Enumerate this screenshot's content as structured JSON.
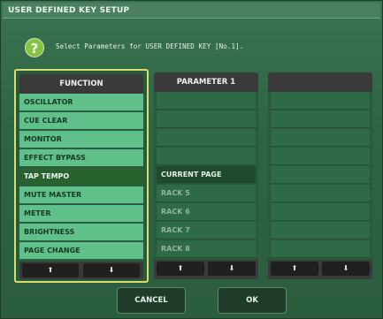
{
  "window": {
    "title": "USER DEFINED KEY SETUP"
  },
  "help": {
    "icon": "question-icon",
    "glyph": "?"
  },
  "message": "Select Parameters for USER DEFINED KEY [No.1].",
  "function_column": {
    "header": "FUNCTION",
    "items": [
      {
        "label": "OSCILLATOR",
        "selected": false
      },
      {
        "label": "CUE CLEAR",
        "selected": false
      },
      {
        "label": "MONITOR",
        "selected": false
      },
      {
        "label": "EFFECT BYPASS",
        "selected": false
      },
      {
        "label": "TAP TEMPO",
        "selected": true
      },
      {
        "label": "MUTE MASTER",
        "selected": false
      },
      {
        "label": "METER",
        "selected": false
      },
      {
        "label": "BRIGHTNESS",
        "selected": false
      },
      {
        "label": "PAGE CHANGE",
        "selected": false
      }
    ],
    "up_icon": "arrow-up-icon",
    "down_icon": "arrow-down-icon",
    "up_glyph": "⬆",
    "down_glyph": "⬇"
  },
  "parameter1_column": {
    "header": "PARAMETER 1",
    "items": [
      "",
      "",
      "",
      "",
      "CURRENT PAGE",
      "RACK 5",
      "RACK 6",
      "RACK 7",
      "RACK 8"
    ],
    "active_index": 4,
    "up_glyph": "⬆",
    "down_glyph": "⬇"
  },
  "parameter2_column": {
    "header": "",
    "up_glyph": "⬆",
    "down_glyph": "⬇"
  },
  "buttons": {
    "cancel": "CANCEL",
    "ok": "OK"
  },
  "colors": {
    "accent": "#d9dc6e",
    "list_green": "#5fc08a",
    "selected_row": "#28632f",
    "background": "#2f6443"
  }
}
